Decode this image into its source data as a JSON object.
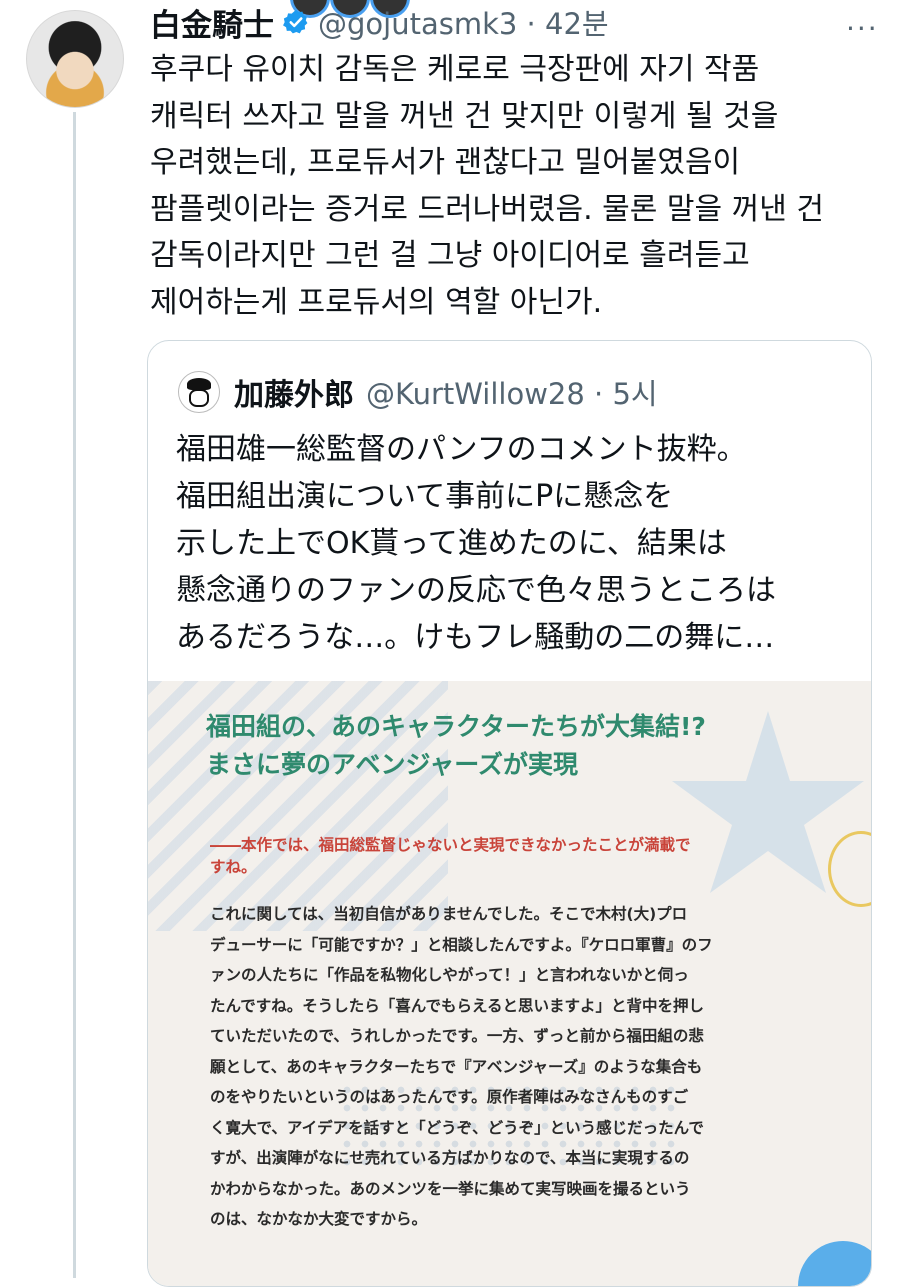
{
  "tweet": {
    "display_name": "白金騎士",
    "handle_time": "@gojutasmk3 · 42분",
    "more_label": "···",
    "text_lines": [
      "후쿠다 유이치 감독은 케로로 극장판에 자기 작품",
      "캐릭터 쓰자고 말을 꺼낸 건 맞지만 이렇게 될 것을",
      "우려했는데, 프로듀서가 괜찮다고 밀어붙였음이",
      "팜플렛이라는 증거로 드러나버렸음. 물론 말을 꺼낸 건",
      "감독이라지만 그런 걸 그냥 아이디어로 흘려듣고",
      "제어하는게 프로듀서의 역할 아닌가."
    ]
  },
  "quote": {
    "display_name": "加藤外郎",
    "handle_time": "@KurtWillow28 · 5시",
    "text_lines": [
      "福田雄一総監督のパンフのコメント抜粋。",
      "福田組出演について事前にPに懸念を",
      "示した上でOK貰って進めたのに、結果は",
      "懸念通りのファンの反応で色々思うところは",
      "あるだろうな…。けもフレ騒動の二の舞に…"
    ],
    "image": {
      "heading_lines": [
        "福田組の、あのキャラクターたちが大集結!?",
        "まさに夢のアベンジャーズが実現"
      ],
      "question_lines": [
        "――本作では、福田総監督じゃないと実現できなかったことが満載で",
        "すね。"
      ],
      "answer_lines": [
        "これに関しては、当初自信がありませんでした。そこで木村(大)プロ",
        "デューサーに「可能ですか？」と相談したんですよ。『ケロロ軍曹』のフ",
        "ァンの人たちに「作品を私物化しやがって！」と言われないかと伺っ",
        "たんですね。そうしたら「喜んでもらえると思いますよ」と背中を押し",
        "ていただいたので、うれしかったです。一方、ずっと前から福田組の悲",
        "願として、あのキャラクターたちで『アベンジャーズ』のような集合も",
        "のをやりたいというのはあったんです。原作者陣はみなさんものすご",
        "く寛大で、アイデアを話すと「どうぞ、どうぞ」という感じだったんで",
        "すが、出演陣がなにせ売れている方ばかりなので、本当に実現するの",
        "かわからなかった。あのメンツを一挙に集めて実写映画を撮るという",
        "のは、なかなか大変ですから。"
      ]
    }
  },
  "colors": {
    "verified": "#1d9bf0",
    "secondary_text": "#536471",
    "heading_green": "#2f8a6e",
    "question_red": "#c9443a"
  },
  "icons": {
    "verified": "verified-badge-icon",
    "more": "more-options-icon"
  }
}
